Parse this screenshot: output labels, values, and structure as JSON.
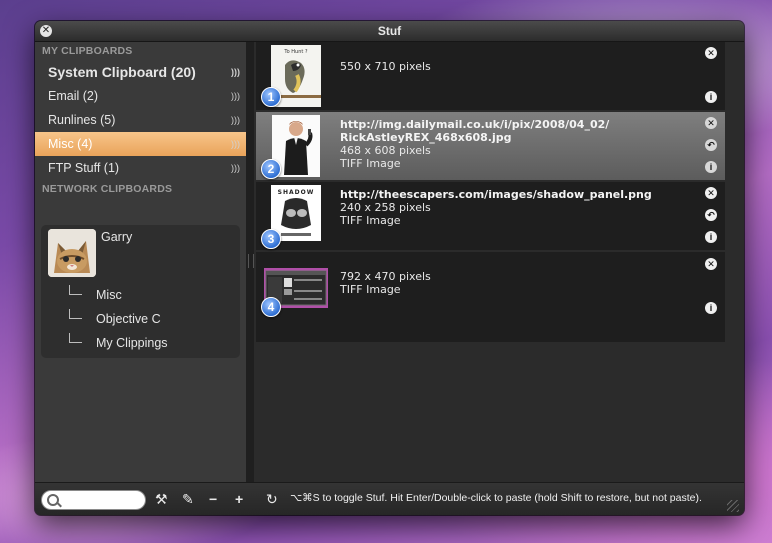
{
  "window": {
    "title": "Stuf"
  },
  "sidebar": {
    "my_header": "MY CLIPBOARDS",
    "items": [
      {
        "label": "System Clipboard (20)"
      },
      {
        "label": "Email (2)"
      },
      {
        "label": "Runlines (5)"
      },
      {
        "label": "Misc (4)"
      },
      {
        "label": "FTP Stuff (1)"
      }
    ],
    "network_header": "NETWORK CLIPBOARDS",
    "network": {
      "user": "Garry",
      "subitems": [
        "Misc",
        "Objective C",
        "My Clippings"
      ]
    }
  },
  "clips": [
    {
      "number": "1",
      "url1": "",
      "url2": "",
      "dims": "550 x 710 pixels",
      "type": ""
    },
    {
      "number": "2",
      "url1": "http://img.dailymail.co.uk/i/pix/2008/04_02/",
      "url2": "RickAstleyREX_468x608.jpg",
      "dims": "468 x 608 pixels",
      "type": "TIFF Image"
    },
    {
      "number": "3",
      "url1": "http://theescapers.com/images/shadow_panel.png",
      "url2": "",
      "dims": "240 x 258 pixels",
      "type": "TIFF Image"
    },
    {
      "number": "4",
      "url1": "",
      "url2": "",
      "dims": "792 x 470 pixels",
      "type": "TIFF Image"
    }
  ],
  "thumb_captions": {
    "bird": "To Hunt ?",
    "shadow": "SHADOW"
  },
  "toolbar": {
    "search_placeholder": "",
    "status": "⌥⌘S to toggle Stuf. Hit Enter/Double-click to paste (hold Shift to restore, but not paste)."
  },
  "icons": {
    "close": "close-icon",
    "broadcast": "broadcast-icon",
    "restore": "restore-icon",
    "info": "info-icon",
    "tools": "tools-icon",
    "pencil": "pencil-icon",
    "minus": "minus-icon",
    "plus": "plus-icon",
    "refresh": "refresh-icon",
    "search": "search-icon"
  }
}
